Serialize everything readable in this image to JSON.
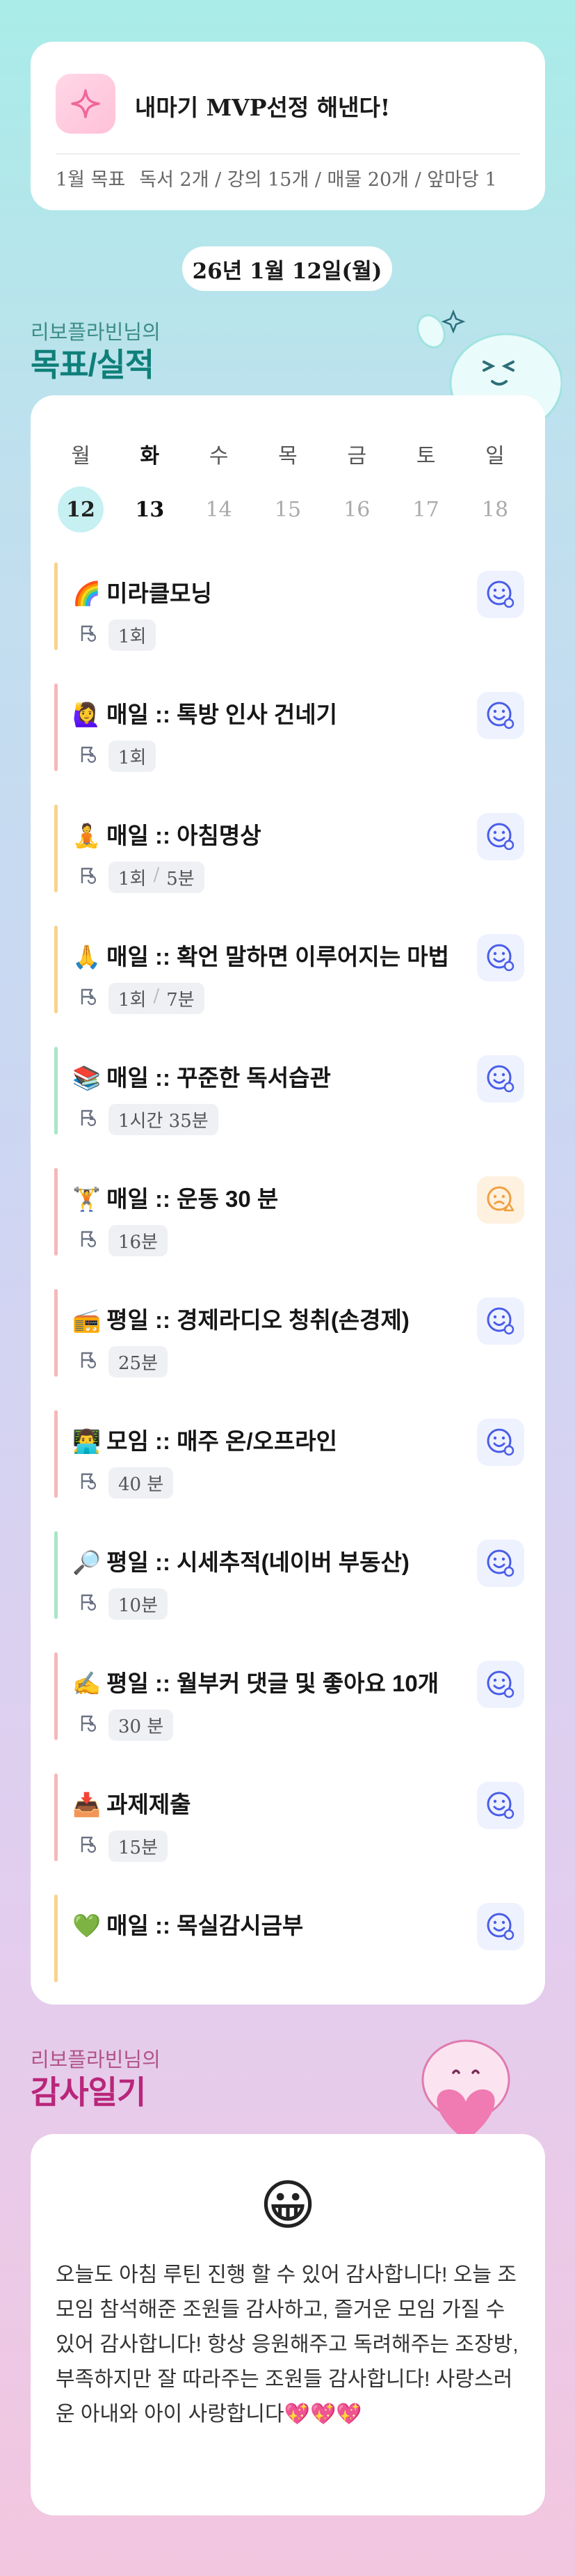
{
  "goal": {
    "title": "내마기 MVP선정 해낸다!",
    "month_label": "1월 목표",
    "targets": [
      "독서 2개 / 강의 15개 / 매물 20개 / 앞마당 1"
    ]
  },
  "date_label": "26년 1월 12일(월)",
  "goals_section": {
    "sub": "리보플라빈님의",
    "title": "목표/실적"
  },
  "calendar": {
    "weekdays": [
      "월",
      "화",
      "수",
      "목",
      "금",
      "토",
      "일"
    ],
    "dates": [
      "12",
      "13",
      "14",
      "15",
      "16",
      "17",
      "18"
    ]
  },
  "routines": [
    {
      "emoji": "🌈",
      "title": "미라클모닝",
      "stats": [
        "1회"
      ],
      "bar": "#f7d38a",
      "status": "smile-icon"
    },
    {
      "emoji": "🙋‍♀️",
      "title": "매일 :: 톡방 인사 건네기",
      "stats": [
        "1회"
      ],
      "bar": "#f6b8b8",
      "status": "smile-icon"
    },
    {
      "emoji": "🧘",
      "title": "매일 :: 아침명상",
      "stats": [
        "1회",
        "5분"
      ],
      "bar": "#f7d38a",
      "status": "smile-icon"
    },
    {
      "emoji": "🙏",
      "title": "매일 :: 확언 말하면 이루어지는 마법",
      "stats": [
        "1회",
        "7분"
      ],
      "bar": "#f7d38a",
      "status": "smile-icon"
    },
    {
      "emoji": "📚",
      "title": "매일 :: 꾸준한 독서습관",
      "stats": [
        "1시간 35분"
      ],
      "bar": "#a8e6c6",
      "status": "smile-icon"
    },
    {
      "emoji": "🏋️",
      "title": "매일 :: 운동 30 분",
      "stats": [
        "16분"
      ],
      "bar": "#f6b8b8",
      "status": "warn-face-icon"
    },
    {
      "emoji": "📻",
      "title": "평일 :: 경제라디오 청취(손경제)",
      "stats": [
        "25분"
      ],
      "bar": "#f6b8b8",
      "status": "smile-icon"
    },
    {
      "emoji": "👨‍💻",
      "title": "모임 :: 매주 온/오프라인",
      "stats": [
        "40 분"
      ],
      "bar": "#f6b8b8",
      "status": "smile-icon"
    },
    {
      "emoji": "🔎",
      "title": "평일 :: 시세추적(네이버 부동산)",
      "stats": [
        "10분"
      ],
      "bar": "#a8e6c6",
      "status": "smile-icon"
    },
    {
      "emoji": "✍️",
      "title": "평일 :: 월부커 댓글 및 좋아요 10개",
      "stats": [
        "30 분"
      ],
      "bar": "#f6b8b8",
      "status": "smile-icon"
    },
    {
      "emoji": "📥",
      "title": "과제제출",
      "stats": [
        "15분"
      ],
      "bar": "#f6b8b8",
      "status": "smile-icon"
    },
    {
      "emoji": "💚",
      "title": "매일 :: 목실감시금부",
      "stats": [],
      "bar": "#f7d38a",
      "status": "smile-icon"
    }
  ],
  "gratitude_section": {
    "sub": "리보플라빈님의",
    "title": "감사일기"
  },
  "diary": {
    "emoji": "😀",
    "text": "오늘도 아침 루틴 진행 할 수 있어 감사합니다! 오늘 조모임 참석해준 조원들 감사하고, 즐거운 모임 가질 수 있어 감사합니다! 항상 응원해주고 독려해주는 조장방, 부족하지만 잘 따라주는 조원들 감사합니다! 사랑스러운 아내와 아이 사랑합니다💖💖💖"
  },
  "colors": {
    "accent": "#0f7f79",
    "selected_date": "#c6f0f2",
    "status_bg": "#eef2ff",
    "warn_bg": "#fff1df"
  }
}
